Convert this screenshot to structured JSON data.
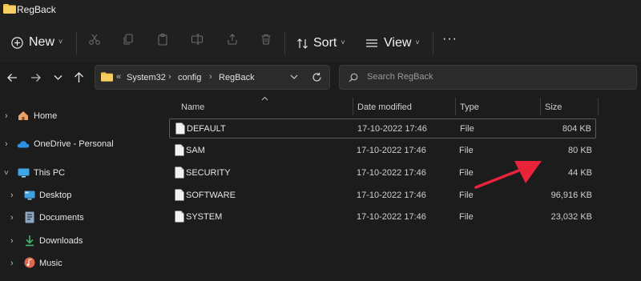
{
  "window": {
    "title": "RegBack"
  },
  "toolbar": {
    "new_label": "New",
    "sort_label": "Sort",
    "view_label": "View",
    "more_label": "···"
  },
  "address": {
    "overflow": "«",
    "crumbs": [
      "System32",
      "config",
      "RegBack"
    ],
    "separator": "›"
  },
  "search": {
    "placeholder": "Search RegBack"
  },
  "nav": {
    "items": [
      {
        "label": "Home"
      },
      {
        "label": "OneDrive - Personal"
      },
      {
        "label": "This PC"
      },
      {
        "label": "Desktop"
      },
      {
        "label": "Documents"
      },
      {
        "label": "Downloads"
      },
      {
        "label": "Music"
      }
    ]
  },
  "columns": {
    "name": "Name",
    "date": "Date modified",
    "type": "Type",
    "size": "Size"
  },
  "files": [
    {
      "name": "DEFAULT",
      "date": "17-10-2022 17:46",
      "type": "File",
      "size": "804 KB"
    },
    {
      "name": "SAM",
      "date": "17-10-2022 17:46",
      "type": "File",
      "size": "80 KB"
    },
    {
      "name": "SECURITY",
      "date": "17-10-2022 17:46",
      "type": "File",
      "size": "44 KB"
    },
    {
      "name": "SOFTWARE",
      "date": "17-10-2022 17:46",
      "type": "File",
      "size": "96,916 KB"
    },
    {
      "name": "SYSTEM",
      "date": "17-10-2022 17:46",
      "type": "File",
      "size": "23,032 KB"
    }
  ],
  "colors": {
    "accent_arrow": "#e8233a",
    "folder": "#f2c34d"
  }
}
